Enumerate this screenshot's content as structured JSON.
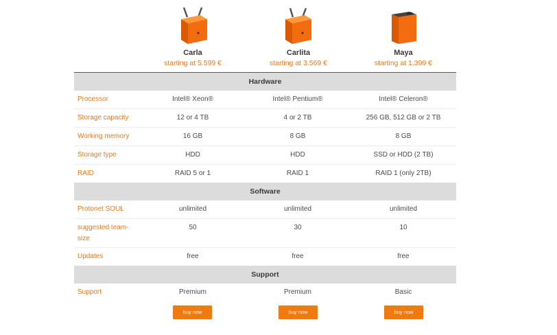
{
  "products": [
    {
      "name": "Carla",
      "price": "starting at 5.599 €",
      "icon": "server-cube-antennas-icon"
    },
    {
      "name": "Carlita",
      "price": "starting at 3.569 €",
      "icon": "server-cube-antennas-icon"
    },
    {
      "name": "Maya",
      "price": "starting at 1.399 €",
      "icon": "server-tower-icon"
    }
  ],
  "sections": {
    "hardware": "Hardware",
    "software": "Software",
    "support": "Support"
  },
  "rows": {
    "processor": {
      "label": "Processor",
      "values": [
        "Intel® Xeon®",
        "Intel® Pentium®",
        "Intel® Celeron®"
      ]
    },
    "storage_capacity": {
      "label": "Storage capacity",
      "values": [
        "12 or 4 TB",
        "4 or 2 TB",
        "256 GB, 512 GB or 2 TB"
      ]
    },
    "working_memory": {
      "label": "Working memory",
      "values": [
        "16 GB",
        "8 GB",
        "8 GB"
      ]
    },
    "storage_type": {
      "label": "Storage type",
      "values": [
        "HDD",
        "HDD",
        "SSD or HDD (2 TB)"
      ]
    },
    "raid": {
      "label": "RAID",
      "values": [
        "RAID 5 or 1",
        "RAID 1",
        "RAID 1 (only 2TB)"
      ]
    },
    "soul": {
      "label": "Protonet SOUL",
      "values": [
        "unlimited",
        "unlimited",
        "unlimited"
      ]
    },
    "team_size": {
      "label": "suggested team-size",
      "values": [
        "50",
        "30",
        "10"
      ]
    },
    "updates": {
      "label": "Updates",
      "values": [
        "free",
        "free",
        "free"
      ]
    },
    "support": {
      "label": "Support",
      "values": [
        "Premium",
        "Premium",
        "Basic"
      ]
    }
  },
  "buy_label": "buy now",
  "colors": {
    "accent": "#e87a1c",
    "button": "#f07a12",
    "section_bg": "#dcdcdc"
  }
}
